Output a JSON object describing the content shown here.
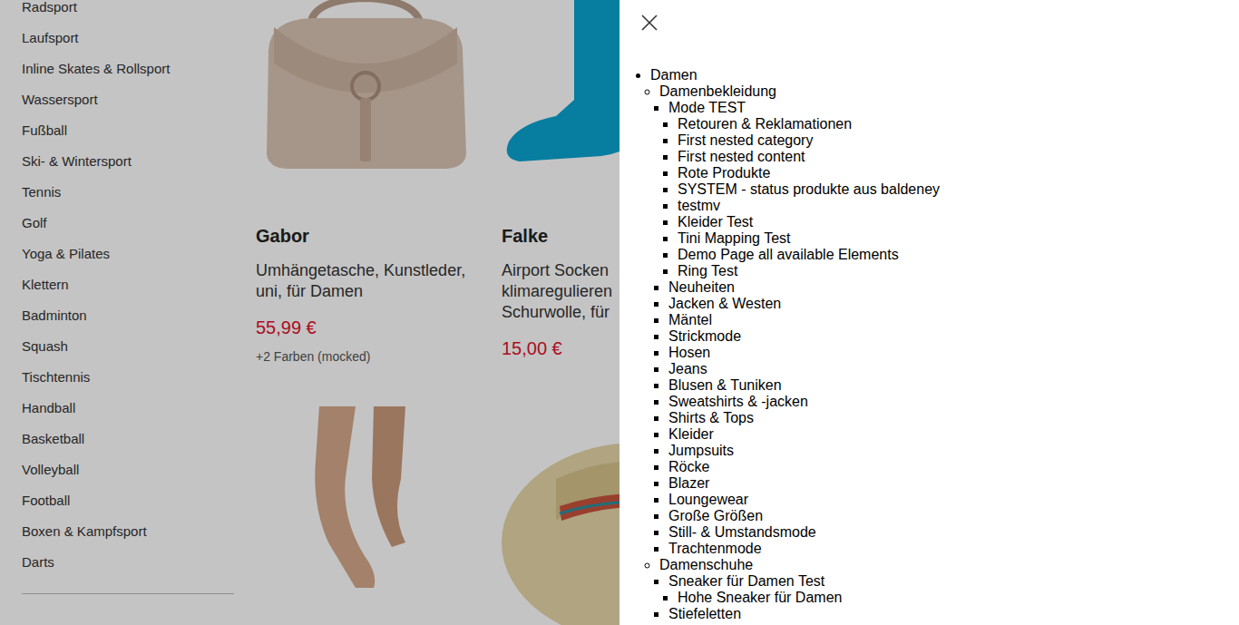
{
  "sidebar": {
    "items": [
      "Radsport",
      "Laufsport",
      "Inline Skates & Rollsport",
      "Wassersport",
      "Fußball",
      "Ski- & Wintersport",
      "Tennis",
      "Golf",
      "Yoga & Pilates",
      "Klettern",
      "Badminton",
      "Squash",
      "Tischtennis",
      "Handball",
      "Basketball",
      "Volleyball",
      "Football",
      "Boxen & Kampfsport",
      "Darts"
    ]
  },
  "products": [
    {
      "kind": "card",
      "brand": "Gabor",
      "title_lines": [
        "Umhängetasche, Kunstleder,",
        "uni, für Damen"
      ],
      "price": "55,99 €",
      "note": "+2 Farben (mocked)"
    },
    {
      "kind": "card",
      "brand": "Falke",
      "title_lines": [
        "Airport Socken",
        "klimaregulieren",
        "Schurwolle, für"
      ],
      "price": "15,00 €"
    },
    {
      "kind": "photo"
    },
    {
      "kind": "photo"
    }
  ],
  "panel": {
    "items": [
      {
        "label": "Damen",
        "children": [
          {
            "label": "Damenbekleidung",
            "children": [
              {
                "label": "Mode TEST",
                "children": [
                  {
                    "label": "Retouren & Reklamationen"
                  },
                  {
                    "label": "First nested category"
                  },
                  {
                    "label": "First nested content"
                  },
                  {
                    "label": "Rote Produkte"
                  },
                  {
                    "label": "SYSTEM - status produkte aus baldeney"
                  },
                  {
                    "label": "testmv"
                  },
                  {
                    "label": "Kleider Test"
                  },
                  {
                    "label": "Tini Mapping Test"
                  },
                  {
                    "label": "Demo Page all available Elements"
                  },
                  {
                    "label": "Ring Test"
                  }
                ]
              },
              {
                "label": "Neuheiten"
              },
              {
                "label": "Jacken & Westen"
              },
              {
                "label": "Mäntel"
              },
              {
                "label": "Strickmode"
              },
              {
                "label": "Hosen"
              },
              {
                "label": "Jeans"
              },
              {
                "label": "Blusen & Tuniken"
              },
              {
                "label": "Sweatshirts & -jacken"
              },
              {
                "label": "Shirts & Tops"
              },
              {
                "label": "Kleider"
              },
              {
                "label": "Jumpsuits"
              },
              {
                "label": "Röcke"
              },
              {
                "label": "Blazer"
              },
              {
                "label": "Loungewear"
              },
              {
                "label": "Große Größen"
              },
              {
                "label": "Still- & Umstandsmode"
              },
              {
                "label": "Trachtenmode"
              }
            ]
          },
          {
            "label": "Damenschuhe",
            "children": [
              {
                "label": "Sneaker für Damen Test",
                "children": [
                  {
                    "label": "Hohe Sneaker für Damen"
                  }
                ]
              },
              {
                "label": "Stiefeletten"
              }
            ]
          }
        ]
      }
    ]
  }
}
